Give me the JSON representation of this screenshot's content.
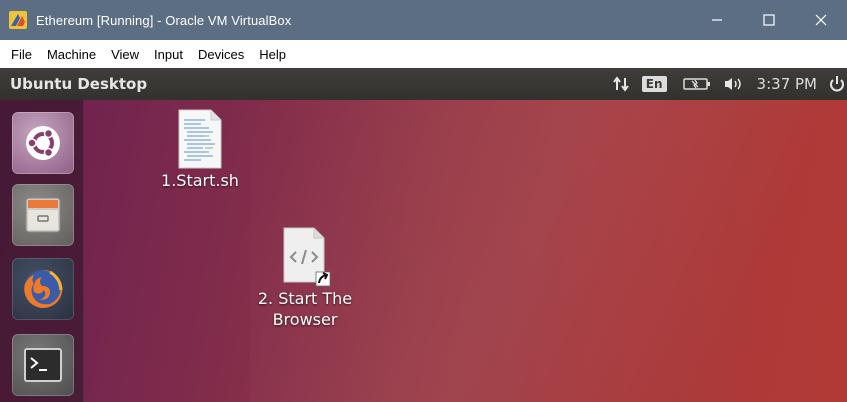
{
  "window": {
    "title": "Ethereum [Running] - Oracle VM VirtualBox",
    "app_icon": "virtualbox-icon",
    "controls": [
      "minimize-icon",
      "maximize-icon",
      "close-icon"
    ]
  },
  "menubar": {
    "items": [
      "File",
      "Machine",
      "View",
      "Input",
      "Devices",
      "Help"
    ]
  },
  "panel": {
    "title": "Ubuntu Desktop",
    "keyboard_layout": "En",
    "clock": "3:37 PM",
    "indicators": [
      "network-icon",
      "keyboard-layout",
      "battery-icon",
      "volume-icon",
      "clock",
      "power-icon"
    ]
  },
  "launcher": {
    "items": [
      "ubuntu-dash-icon",
      "files-icon",
      "firefox-icon",
      "terminal-icon"
    ]
  },
  "desktop": {
    "icons": [
      {
        "label": "1.Start.sh",
        "icon": "shell-script-icon"
      },
      {
        "label": "2. Start The Browser",
        "icon": "html-shortcut-icon"
      }
    ]
  },
  "colors": {
    "titlebar": "#5b6e83",
    "panel": "#3a3936",
    "desktop_left": "#6a2050",
    "desktop_right": "#b23a35"
  }
}
